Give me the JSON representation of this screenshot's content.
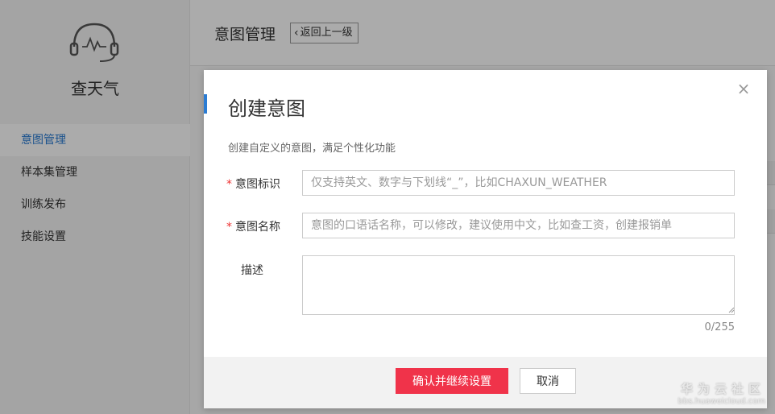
{
  "sidebar": {
    "app_name": "查天气",
    "items": [
      {
        "label": "意图管理",
        "active": true
      },
      {
        "label": "样本集管理",
        "active": false
      },
      {
        "label": "训练发布",
        "active": false
      },
      {
        "label": "技能设置",
        "active": false
      }
    ]
  },
  "header": {
    "title": "意图管理",
    "back_label": "返回上一级"
  },
  "modal": {
    "title": "创建意图",
    "description": "创建自定义的意图，满足个性化功能",
    "close_symbol": "×",
    "fields": {
      "intent_id": {
        "label": "意图标识",
        "required_mark": "*",
        "value": "",
        "placeholder": "仅支持英文、数字与下划线“_”，比如CHAXUN_WEATHER"
      },
      "intent_name": {
        "label": "意图名称",
        "required_mark": "*",
        "value": "",
        "placeholder": "意图的口语话名称，可以修改，建议使用中文，比如查工资，创建报销单"
      },
      "description": {
        "label": "描述",
        "value": "",
        "counter": "0/255"
      }
    },
    "confirm_label": "确认并继续设置",
    "cancel_label": "取消"
  },
  "colors": {
    "accent_blue": "#2b7cd3",
    "primary_red": "#f0334a",
    "required_red": "#e33333"
  },
  "watermark": {
    "title": "华为云社区",
    "url": "bbs.huaweicloud.com"
  }
}
